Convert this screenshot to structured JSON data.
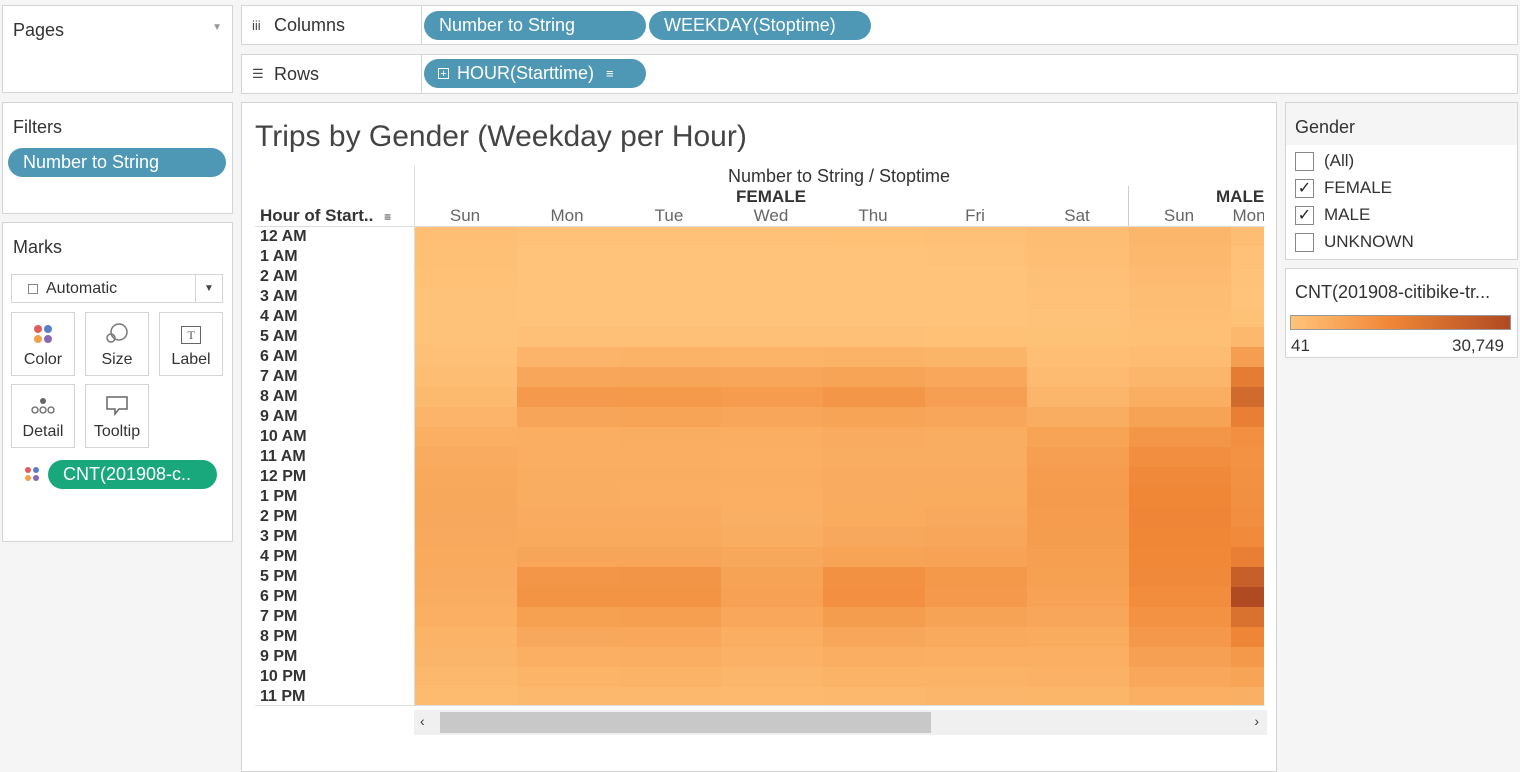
{
  "pages": {
    "title": "Pages"
  },
  "columns_shelf": {
    "label": "Columns",
    "pills": [
      "Number to String",
      "WEEKDAY(Stoptime)"
    ]
  },
  "rows_shelf": {
    "label": "Rows",
    "pill": "HOUR(Starttime)"
  },
  "filters": {
    "title": "Filters",
    "pill": "Number to String"
  },
  "marks": {
    "title": "Marks",
    "type": "Automatic",
    "buttons": {
      "color": "Color",
      "size": "Size",
      "label": "Label",
      "detail": "Detail",
      "tooltip": "Tooltip"
    },
    "field": "CNT(201908-c.."
  },
  "viz": {
    "title": "Trips by Gender (Weekday per Hour)",
    "column_header": "Number to String / Stoptime",
    "row_header": "Hour of Start..",
    "groups": [
      "FEMALE",
      "MALE"
    ],
    "days_female": [
      "Sun",
      "Mon",
      "Tue",
      "Wed",
      "Thu",
      "Fri",
      "Sat"
    ],
    "days_male": [
      "Sun",
      "Mon"
    ]
  },
  "legend": {
    "gender_title": "Gender",
    "items": [
      {
        "label": "(All)",
        "checked": false
      },
      {
        "label": "FEMALE",
        "checked": true
      },
      {
        "label": "MALE",
        "checked": true
      },
      {
        "label": "UNKNOWN",
        "checked": false
      }
    ],
    "color_title": "CNT(201908-citibike-tr...",
    "color_min": "41",
    "color_max": "30,749",
    "color_low": "#ffc47a",
    "color_high": "#b04a22"
  },
  "chart_data": {
    "type": "heatmap",
    "title": "Trips by Gender (Weekday per Hour)",
    "xlabel": "Number to String / Stoptime",
    "ylabel": "Hour of Start..",
    "rows": [
      "12 AM",
      "1 AM",
      "2 AM",
      "3 AM",
      "4 AM",
      "5 AM",
      "6 AM",
      "7 AM",
      "8 AM",
      "9 AM",
      "10 AM",
      "11 AM",
      "12 PM",
      "1 PM",
      "2 PM",
      "3 PM",
      "4 PM",
      "5 PM",
      "6 PM",
      "7 PM",
      "8 PM",
      "9 PM",
      "10 PM",
      "11 PM"
    ],
    "columns": [
      "FEMALE Sun",
      "FEMALE Mon",
      "FEMALE Tue",
      "FEMALE Wed",
      "FEMALE Thu",
      "FEMALE Fri",
      "FEMALE Sat",
      "MALE Sun",
      "MALE Mon"
    ],
    "color_range": [
      41,
      30749
    ],
    "values": [
      [
        1400,
        700,
        700,
        700,
        800,
        900,
        1500,
        3200,
        1600
      ],
      [
        1000,
        300,
        300,
        300,
        300,
        400,
        1200,
        2600,
        700
      ],
      [
        800,
        200,
        200,
        200,
        200,
        250,
        900,
        2200,
        500
      ],
      [
        500,
        100,
        100,
        100,
        100,
        150,
        700,
        1500,
        300
      ],
      [
        400,
        200,
        200,
        200,
        200,
        200,
        500,
        1100,
        600
      ],
      [
        500,
        900,
        900,
        900,
        900,
        800,
        600,
        1000,
        2500
      ],
      [
        900,
        3600,
        3800,
        3700,
        3800,
        3500,
        1200,
        1800,
        8800
      ],
      [
        1600,
        6800,
        7000,
        6900,
        7300,
        6500,
        2000,
        3200,
        17000
      ],
      [
        2400,
        9500,
        9700,
        9200,
        10500,
        8600,
        3200,
        5000,
        22000
      ],
      [
        3600,
        7000,
        7200,
        6900,
        7400,
        6600,
        5200,
        7500,
        16000
      ],
      [
        4800,
        5100,
        5200,
        5000,
        5400,
        5200,
        7300,
        10500,
        12000
      ],
      [
        5600,
        5000,
        5100,
        4800,
        5300,
        5200,
        8600,
        12300,
        11300
      ],
      [
        6200,
        5200,
        5200,
        5000,
        5500,
        5600,
        9200,
        13500,
        11500
      ],
      [
        6400,
        5300,
        5100,
        4700,
        5700,
        5800,
        9300,
        13800,
        11800
      ],
      [
        6300,
        5500,
        5400,
        4600,
        5800,
        6100,
        9200,
        14200,
        12300
      ],
      [
        6100,
        6000,
        6000,
        5300,
        6300,
        6700,
        8900,
        13900,
        13000
      ],
      [
        6000,
        7000,
        7000,
        6400,
        7300,
        7700,
        8500,
        13600,
        16000
      ],
      [
        5700,
        10500,
        10800,
        7600,
        11500,
        10000,
        8300,
        13300,
        25000
      ],
      [
        5300,
        11000,
        11200,
        7900,
        12000,
        9600,
        7700,
        12400,
        30749
      ],
      [
        4700,
        8200,
        8500,
        6500,
        8900,
        7600,
        6800,
        11300,
        20000
      ],
      [
        4000,
        6300,
        6500,
        5100,
        6700,
        6000,
        5800,
        9800,
        14000
      ],
      [
        3400,
        4700,
        5000,
        4100,
        5000,
        4900,
        4800,
        8100,
        10000
      ],
      [
        2800,
        3700,
        3800,
        3200,
        3900,
        4000,
        4100,
        6500,
        7200
      ],
      [
        2100,
        2500,
        2600,
        2300,
        2800,
        3100,
        3300,
        4800,
        4500
      ]
    ]
  }
}
